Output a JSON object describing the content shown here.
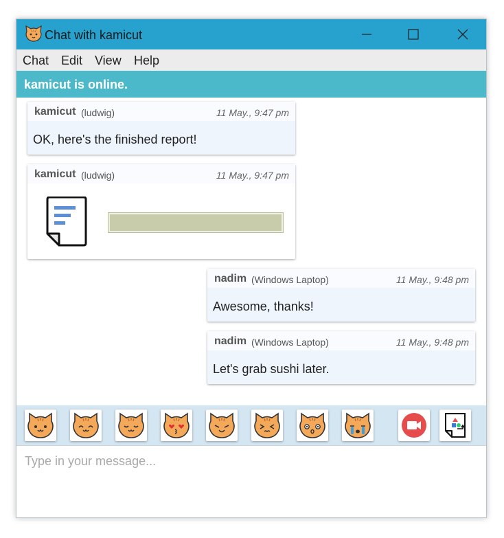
{
  "window": {
    "title": "Chat with kamicut",
    "icon": "cat-face-icon",
    "controls": [
      "minimize-icon",
      "maximize-icon",
      "close-icon"
    ]
  },
  "menu": {
    "items": [
      {
        "label": "Chat"
      },
      {
        "label": "Edit"
      },
      {
        "label": "View"
      },
      {
        "label": "Help"
      }
    ]
  },
  "status": {
    "text": "kamicut is online.",
    "color": "#4bb9c9"
  },
  "messages": [
    {
      "user": "kamicut",
      "device": "(ludwig)",
      "time": "11 May., 9:47 pm",
      "text": "OK, here's the finished report!"
    },
    {
      "user": "kamicut",
      "device": "(ludwig)",
      "time": "11 May., 9:47 pm",
      "attachment": "document-icon"
    },
    {
      "user": "nadim",
      "device": "(Windows Laptop)",
      "time": "11 May., 9:48 pm",
      "text": "Awesome, thanks!"
    },
    {
      "user": "nadim",
      "device": "(Windows Laptop)",
      "time": "11 May., 9:48 pm",
      "text": "Let's grab sushi later."
    }
  ],
  "toolbar": {
    "emoji": [
      "cat-smile-icon",
      "cat-grin-icon",
      "cat-content-icon",
      "cat-kiss-icon",
      "cat-wink-icon",
      "cat-squint-icon",
      "cat-surprised-icon",
      "cat-crying-icon"
    ],
    "video_call": "video-camera-icon",
    "send_file": "file-send-icon"
  },
  "input": {
    "placeholder": "Type in your message...",
    "value": ""
  },
  "colors": {
    "titlebar": "#27a2cf",
    "status": "#4bb9c9",
    "toolbar": "#d4e6f2",
    "bubble": "#eef5fd",
    "cat": "#f4a85a",
    "video": "#e74c4c"
  }
}
